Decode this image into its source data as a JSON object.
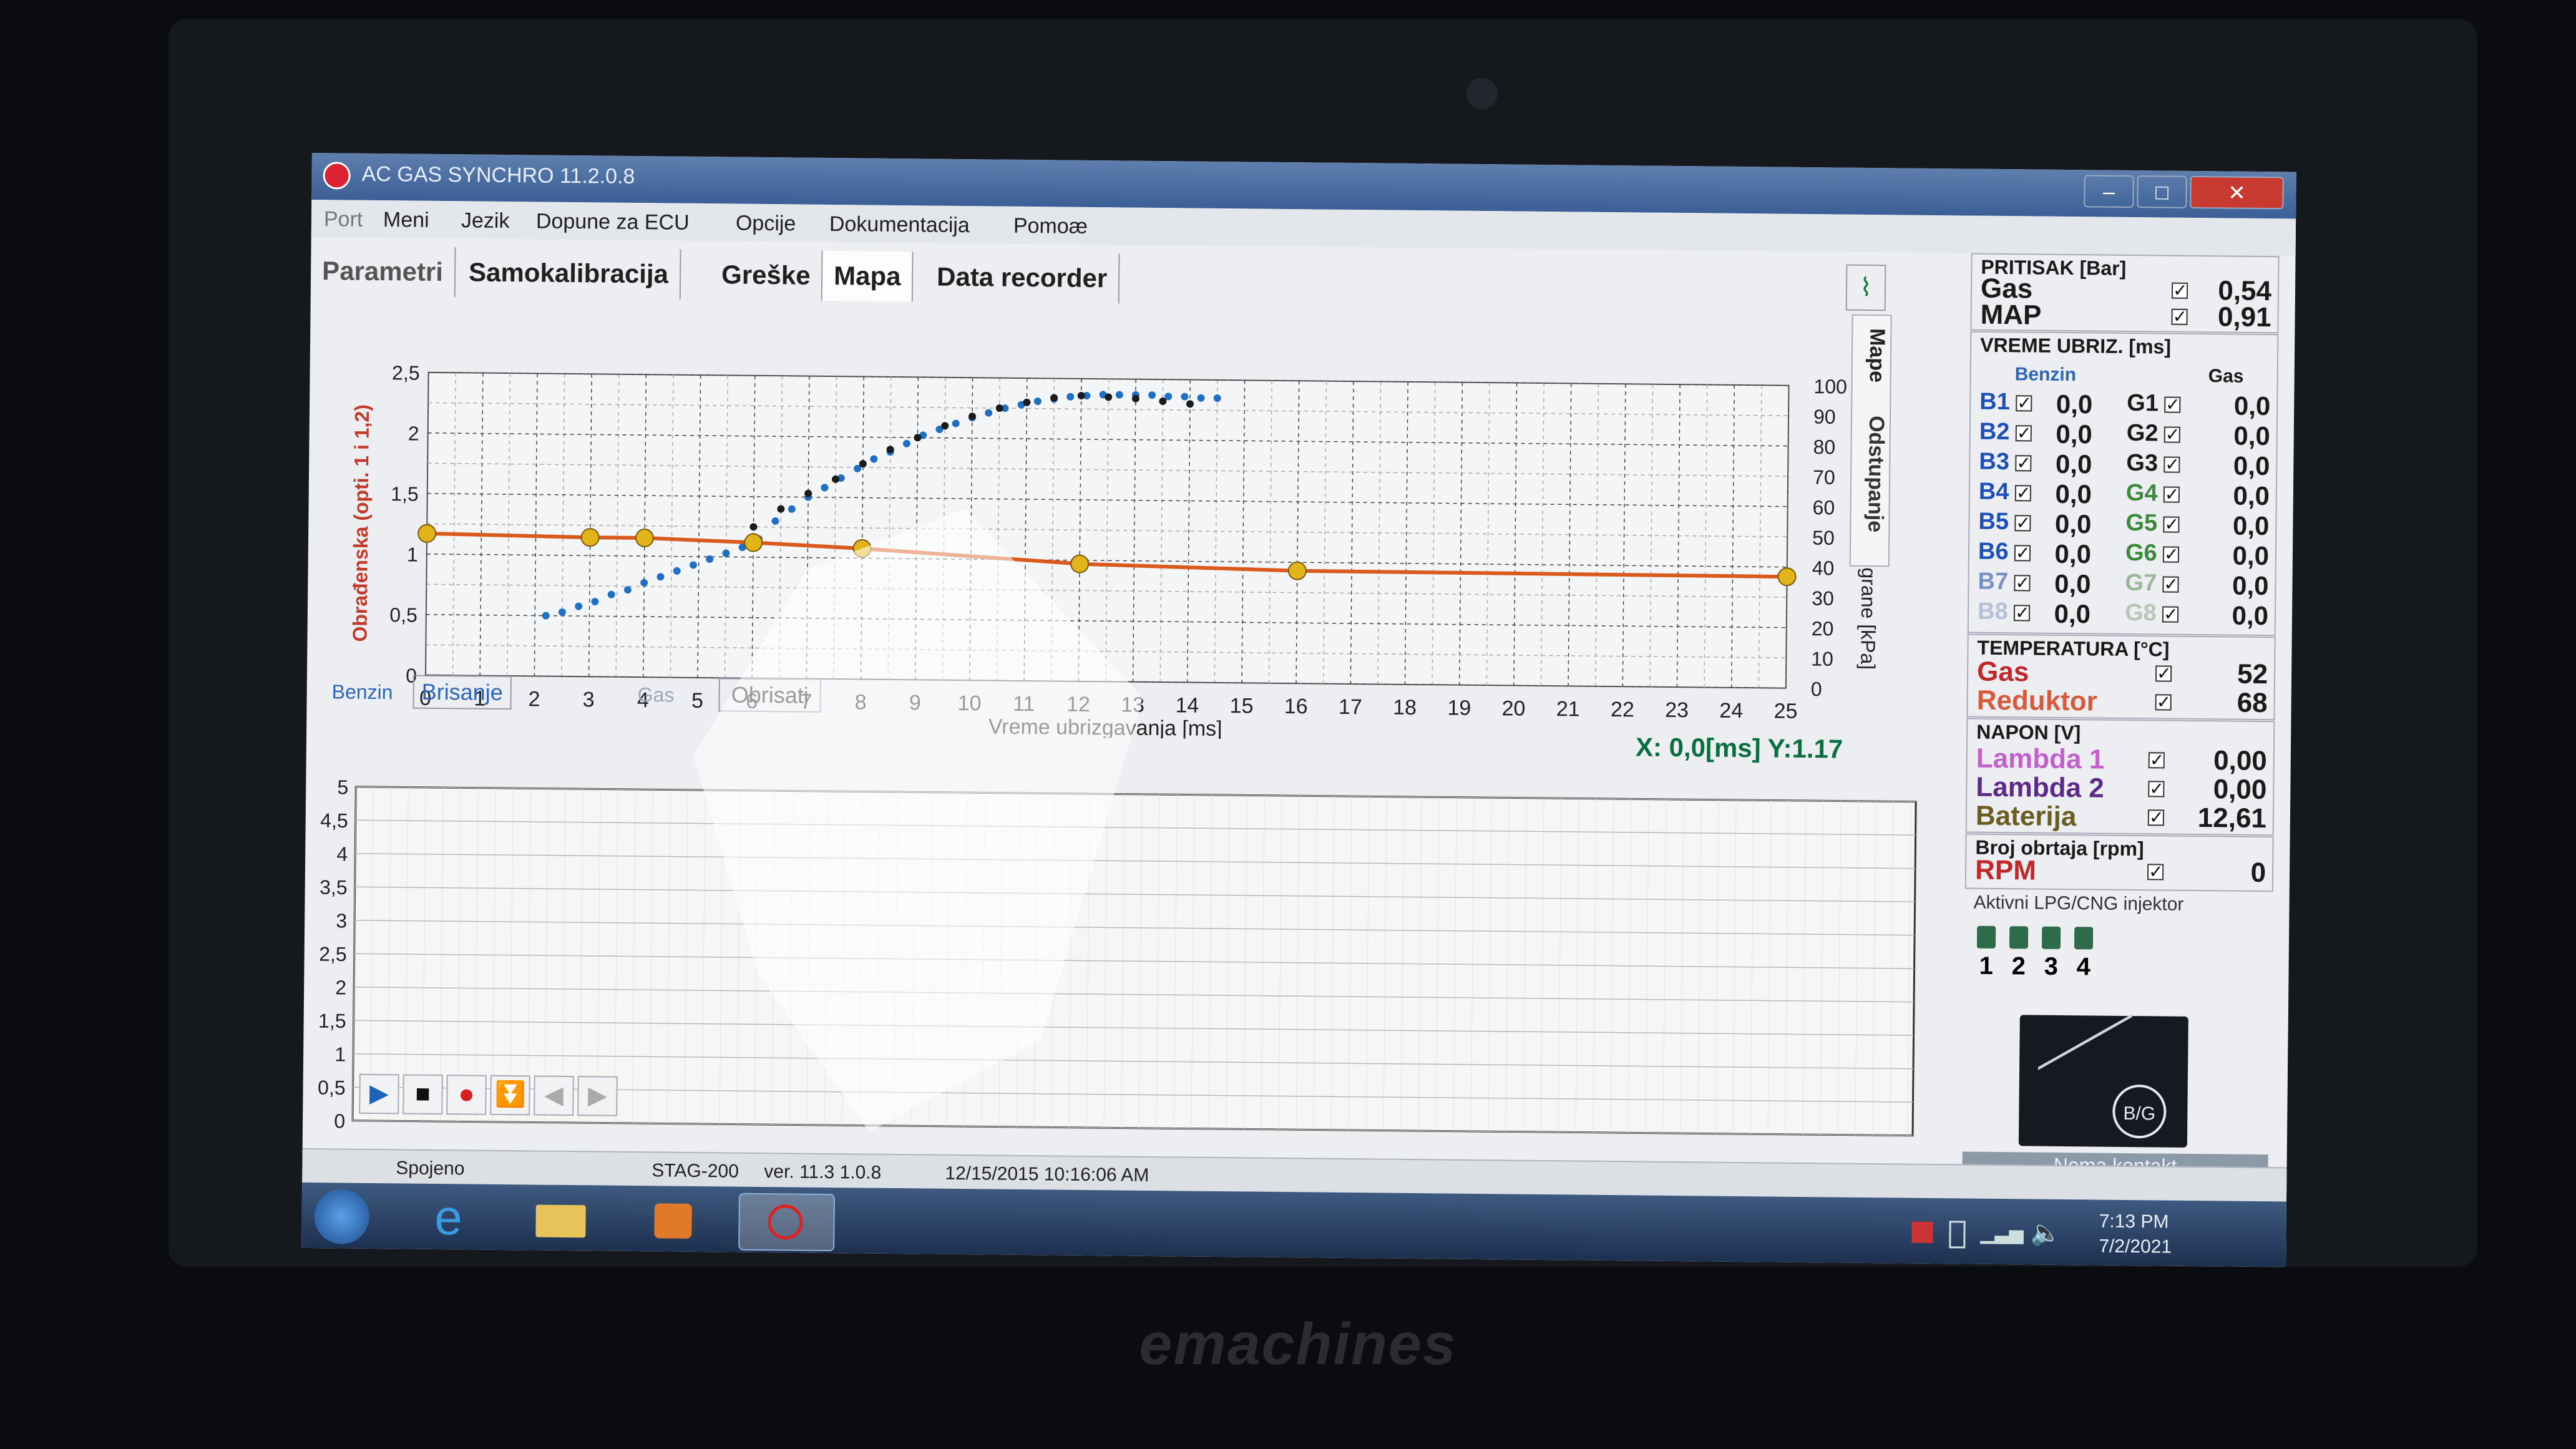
{
  "window": {
    "title": "AC GAS SYNCHRO 11.2.0.8",
    "minimize": "–",
    "maximize": "□",
    "close": "✕"
  },
  "menu": [
    "Port",
    "Meni",
    "Jezik",
    "Dopune za ECU",
    "Opcije",
    "Dokumentacija",
    "Pomoæ"
  ],
  "tabs": [
    "Parametri",
    "Samokalibracija",
    "Greške",
    "Mapa",
    "Data recorder"
  ],
  "side_tabs": {
    "mape": "Mape",
    "odstupanje": "Odstupanje"
  },
  "chart_controls": {
    "benzin": "Benzin",
    "brisanje": "Brisanje",
    "gas": "Gas",
    "obrisati": "Obrisati",
    "coord": "X:  0,0[ms] Y:1.17"
  },
  "chart_data": [
    {
      "type": "scatter",
      "xlabel": "Vreme ubrizgavanja [ms]",
      "ylabel": "Obrađenska (opti. 1 i 1,2)",
      "y2label": "Potpritisak usisne grane [kPa]",
      "xlim": [
        0,
        25
      ],
      "ylim": [
        0,
        2.5
      ],
      "y2lim": [
        0,
        100
      ],
      "x_ticks": [
        0,
        1,
        2,
        3,
        4,
        5,
        6,
        7,
        8,
        9,
        10,
        11,
        12,
        13,
        14,
        15,
        16,
        17,
        18,
        19,
        20,
        21,
        22,
        23,
        24,
        25
      ],
      "y_ticks": [
        "0",
        "0,5",
        "1",
        "1,5",
        "2",
        "2,5"
      ],
      "y2_ticks": [
        0,
        10,
        20,
        30,
        40,
        50,
        60,
        70,
        80,
        90,
        100
      ],
      "grid": true,
      "series": [
        {
          "points": [
            [
              2.2,
              0.5
            ],
            [
              2.5,
              0.53
            ],
            [
              2.8,
              0.58
            ],
            [
              3.1,
              0.62
            ],
            [
              3.4,
              0.68
            ],
            [
              3.7,
              0.72
            ],
            [
              4.0,
              0.78
            ],
            [
              4.3,
              0.83
            ],
            [
              4.6,
              0.88
            ],
            [
              4.9,
              0.93
            ],
            [
              5.2,
              0.98
            ],
            [
              5.5,
              1.03
            ],
            [
              5.8,
              1.08
            ],
            [
              6.1,
              1.15
            ],
            [
              6.4,
              1.3
            ],
            [
              6.7,
              1.4
            ],
            [
              7.0,
              1.5
            ],
            [
              7.3,
              1.58
            ],
            [
              7.6,
              1.66
            ],
            [
              7.9,
              1.74
            ],
            [
              8.2,
              1.82
            ],
            [
              8.5,
              1.88
            ],
            [
              8.8,
              1.95
            ],
            [
              9.1,
              2.02
            ],
            [
              9.4,
              2.07
            ],
            [
              9.7,
              2.12
            ],
            [
              10.0,
              2.17
            ],
            [
              10.3,
              2.21
            ],
            [
              10.6,
              2.25
            ],
            [
              10.9,
              2.28
            ],
            [
              11.2,
              2.31
            ],
            [
              11.5,
              2.33
            ],
            [
              11.8,
              2.35
            ],
            [
              12.1,
              2.36
            ],
            [
              12.4,
              2.37
            ],
            [
              12.7,
              2.37
            ],
            [
              13.0,
              2.37
            ],
            [
              13.3,
              2.37
            ],
            [
              13.6,
              2.36
            ],
            [
              13.9,
              2.36
            ],
            [
              14.2,
              2.35
            ],
            [
              14.5,
              2.35
            ]
          ]
        },
        {
          "points": [
            [
              6.0,
              1.25
            ],
            [
              6.5,
              1.4
            ],
            [
              7.0,
              1.53
            ],
            [
              7.5,
              1.65
            ],
            [
              8.0,
              1.78
            ],
            [
              8.5,
              1.9
            ],
            [
              9.0,
              2.0
            ],
            [
              9.5,
              2.1
            ],
            [
              10.0,
              2.18
            ],
            [
              10.5,
              2.25
            ],
            [
              11.0,
              2.3
            ],
            [
              11.5,
              2.34
            ],
            [
              12.0,
              2.36
            ],
            [
              12.5,
              2.35
            ],
            [
              13.0,
              2.34
            ],
            [
              13.5,
              2.32
            ],
            [
              14.0,
              2.3
            ]
          ]
        },
        {
          "x": [
            0,
            3,
            4,
            6,
            8,
            12,
            16,
            25
          ],
          "y": [
            1.17,
            1.15,
            1.15,
            1.12,
            1.08,
            0.97,
            0.93,
            0.92
          ]
        }
      ]
    },
    {
      "type": "line",
      "ylim": [
        0,
        5
      ],
      "y_ticks": [
        "0",
        "0,5",
        "1",
        "1,5",
        "2",
        "2,5",
        "3",
        "3,5",
        "4",
        "4,5",
        "5"
      ],
      "series": []
    }
  ],
  "recorder_buttons": [
    "play",
    "stop",
    "record",
    "download",
    "prev",
    "next"
  ],
  "right_panel": {
    "pritisak": {
      "title": "PRITISAK [Bar]",
      "rows": [
        {
          "label": "Gas",
          "value": "0,54"
        },
        {
          "label": "MAP",
          "value": "0,91"
        }
      ]
    },
    "vreme": {
      "title": "VREME UBRIZ. [ms]",
      "benzin": "Benzin",
      "gas": "Gas",
      "rows": [
        {
          "b": "B1",
          "bv": "0,0",
          "g": "G1",
          "gv": "0,0"
        },
        {
          "b": "B2",
          "bv": "0,0",
          "g": "G2",
          "gv": "0,0"
        },
        {
          "b": "B3",
          "bv": "0,0",
          "g": "G3",
          "gv": "0,0"
        },
        {
          "b": "B4",
          "bv": "0,0",
          "g": "G4",
          "gv": "0,0"
        },
        {
          "b": "B5",
          "bv": "0,0",
          "g": "G5",
          "gv": "0,0"
        },
        {
          "b": "B6",
          "bv": "0,0",
          "g": "G6",
          "gv": "0,0"
        },
        {
          "b": "B7",
          "bv": "0,0",
          "g": "G7",
          "gv": "0,0"
        },
        {
          "b": "B8",
          "bv": "0,0",
          "g": "G8",
          "gv": "0,0"
        }
      ]
    },
    "temperatura": {
      "title": "TEMPERATURA [°C]",
      "rows": [
        {
          "label": "Gas",
          "value": "52"
        },
        {
          "label": "Reduktor",
          "value": "68"
        }
      ]
    },
    "napon": {
      "title": "NAPON [V]",
      "rows": [
        {
          "label": "Lambda 1",
          "value": "0,00"
        },
        {
          "label": "Lambda 2",
          "value": "0,00"
        },
        {
          "label": "Baterija",
          "value": "12,61"
        }
      ]
    },
    "obrtaji": {
      "title": "Broj obrtaja [rpm]",
      "label": "RPM",
      "value": "0"
    },
    "injektori": {
      "title": "Aktivni LPG/CNG injektor",
      "numbers": [
        "1",
        "2",
        "3",
        "4"
      ]
    },
    "badge": "B/G",
    "nema_kontakt": "Nema kontakt"
  },
  "status": {
    "spojeno": "Spojeno",
    "ecu": "STAG-200",
    "ver": "ver. 11.3  1.0.8",
    "date": "12/15/2015 10:16:06 AM"
  },
  "taskbar": {
    "time": "7:13 PM",
    "date": "7/2/2021"
  },
  "brand": "emachines",
  "colors": {
    "benzin_series": "#1f6fc2",
    "gas_series": "#1b1b1b",
    "correction_line": "#d95a1c",
    "correction_points": "#e2b41c",
    "accent": "#0b6e40"
  }
}
